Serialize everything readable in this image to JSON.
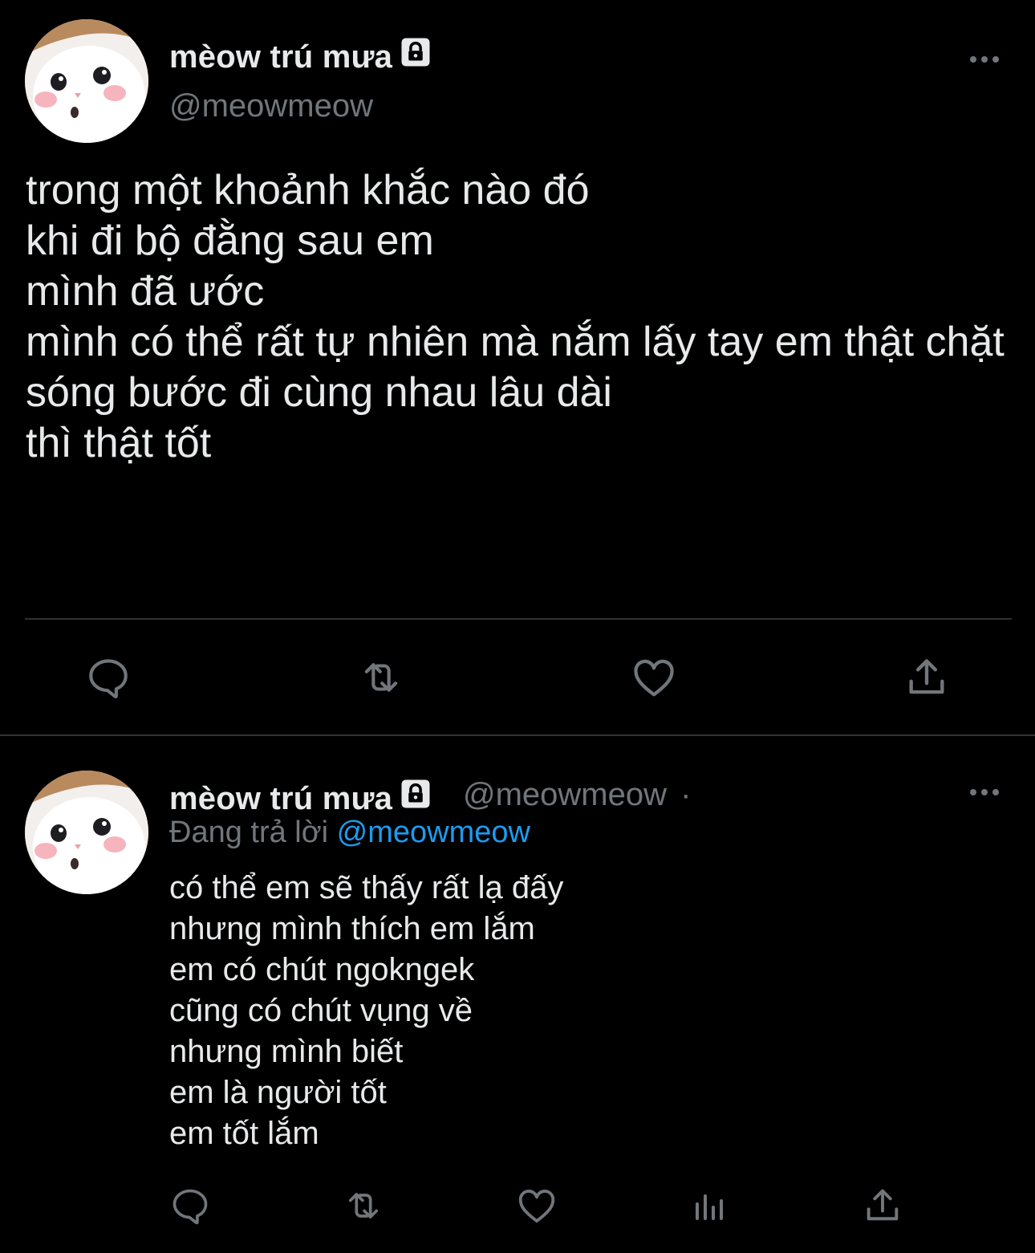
{
  "colors": {
    "background": "#000000",
    "text_primary": "#e7e9ea",
    "text_secondary": "#71767b",
    "link": "#1d9bf0",
    "divider": "#2f3336"
  },
  "main_tweet": {
    "display_name": "mèow trú mưa",
    "handle": "@meowmeow",
    "protected_icon": "lock-icon",
    "more_icon": "more-dots-icon",
    "text": "trong một khoảnh khắc nào đó\nkhi đi bộ đằng sau em\nmình đã ước\nmình có thể rất tự nhiên mà nắm lấy tay em thật chặt\nsóng bước đi cùng nhau lâu dài\nthì thật tốt",
    "actions": [
      "reply-icon",
      "retweet-icon",
      "like-icon",
      "share-icon"
    ]
  },
  "reply_tweet": {
    "display_name": "mèow trú mưa",
    "handle": "@meowmeow",
    "separator": "·",
    "replying_to_label": "Đang trả lời",
    "replying_to_handle": "@meowmeow",
    "text": "có thể em sẽ thấy rất lạ đấy\nnhưng mình thích em lắm\nem có chút ngokngek\ncũng có chút vụng về\nnhưng mình biết\nem là người tốt\nem tốt lắm",
    "actions": [
      "reply-icon",
      "retweet-icon",
      "like-icon",
      "analytics-icon",
      "share-icon"
    ]
  }
}
